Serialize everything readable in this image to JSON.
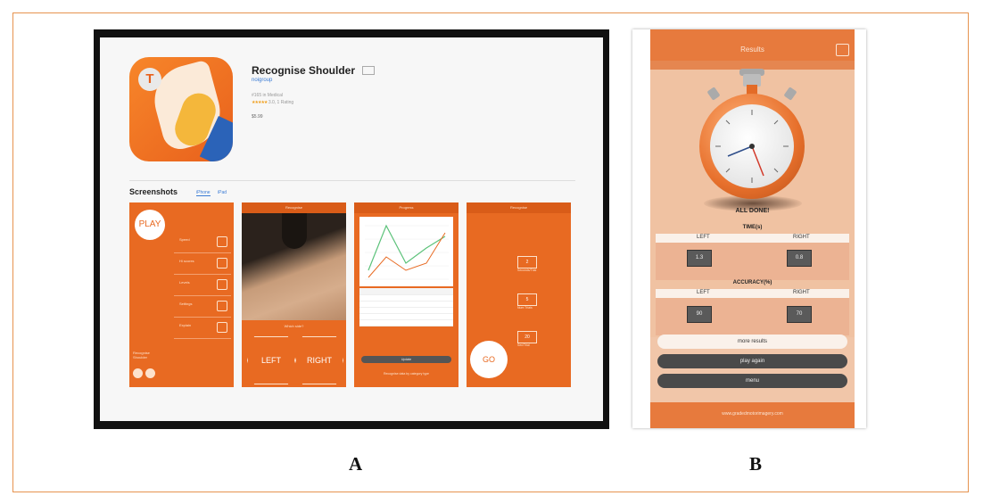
{
  "captions": {
    "a": "A",
    "b": "B"
  },
  "panel_a": {
    "app_name": "Recognise Shoulder",
    "developer": "noigroup",
    "category": "#165 in Medical",
    "rating_stars": "★★★★★",
    "rating_text": "3.0, 1 Rating",
    "price": "$5.99",
    "screenshots_label": "Screenshots",
    "tabs": [
      "iPhone",
      "iPad"
    ],
    "shot1": {
      "play": "PLAY",
      "menu": [
        "Speed",
        "Hi scores",
        "Levels",
        "Settings",
        "Explain"
      ],
      "footer_line1": "Recognise",
      "footer_line2": "Shoulder"
    },
    "shot2": {
      "header": "Recognise",
      "caption": "Which side?",
      "left": "LEFT",
      "right": "RIGHT"
    },
    "shot3": {
      "header": "Progress",
      "update": "Update",
      "footer": "Recognise data by category type"
    },
    "shot4": {
      "header": "Recognise",
      "values": [
        "2",
        "5",
        "20"
      ],
      "labels": [
        "Seconds/Trial",
        "Num Trials",
        "Sec/Trial"
      ],
      "go": "GO"
    },
    "colors": {
      "orange": "#e86a22",
      "light": "#fde2cc"
    }
  },
  "panel_b": {
    "header": "Results",
    "done": "ALL DONE!",
    "time_header": "TIME(s)",
    "accuracy_header": "ACCURACY(%)",
    "left_label": "LEFT",
    "right_label": "RIGHT",
    "time_left": "1.3",
    "time_right": "0.8",
    "acc_left": "90",
    "acc_right": "70",
    "more_results": "more results",
    "play_again": "play again",
    "menu": "menu",
    "footer": "www.gradedmotorimagery.com",
    "colors": {
      "header": "#e77a3d",
      "bg": "#f1c6a9",
      "dark_button": "#4a4a4a"
    }
  }
}
